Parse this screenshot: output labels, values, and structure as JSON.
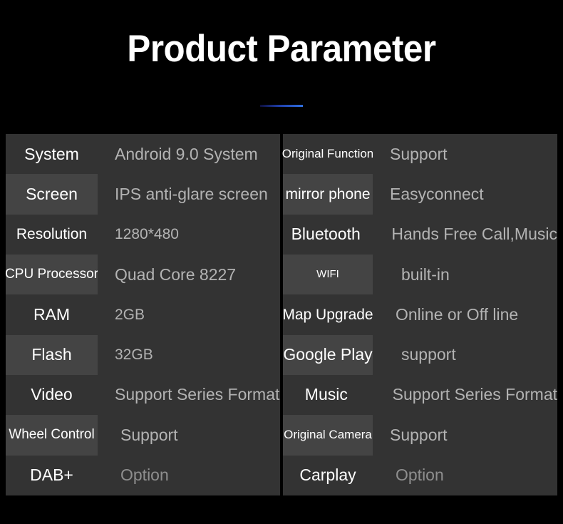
{
  "header": {
    "title": "Product Parameter",
    "accent_color": "#2f6fe0"
  },
  "theme": {
    "background": "#000000",
    "label_cell_dark": "#333333",
    "label_cell_light": "#444444",
    "value_cell": "#333333",
    "label_text": "#ffffff",
    "value_text": "#b3b3b3",
    "value_text_dim": "#8e8e8e"
  },
  "tables": {
    "left": {
      "rows": [
        {
          "label": "System",
          "value": "Android 9.0 System"
        },
        {
          "label": "Screen",
          "value": "IPS anti-glare screen"
        },
        {
          "label": "Resolution",
          "value": "1280*480"
        },
        {
          "label": "CPU Processor",
          "value": "Quad Core 8227"
        },
        {
          "label": "RAM",
          "value": "2GB"
        },
        {
          "label": "Flash",
          "value": "32GB"
        },
        {
          "label": "Video",
          "value": "Support Series Format"
        },
        {
          "label": "Wheel Control",
          "value": "Support"
        },
        {
          "label": "DAB+",
          "value": "Option"
        }
      ]
    },
    "right": {
      "rows": [
        {
          "label": "Original Function",
          "value": "Support"
        },
        {
          "label": "mirror phone",
          "value": "Easyconnect"
        },
        {
          "label": "Bluetooth",
          "value": "Hands Free Call,Music"
        },
        {
          "label": "WIFI",
          "value": "built-in"
        },
        {
          "label": "Map Upgrade",
          "value": "Online or Off line"
        },
        {
          "label": "Google Play",
          "value": "support"
        },
        {
          "label": "Music",
          "value": "Support Series Format"
        },
        {
          "label": "Original Camera",
          "value": "Support"
        },
        {
          "label": "Carplay",
          "value": "Option"
        }
      ]
    }
  }
}
